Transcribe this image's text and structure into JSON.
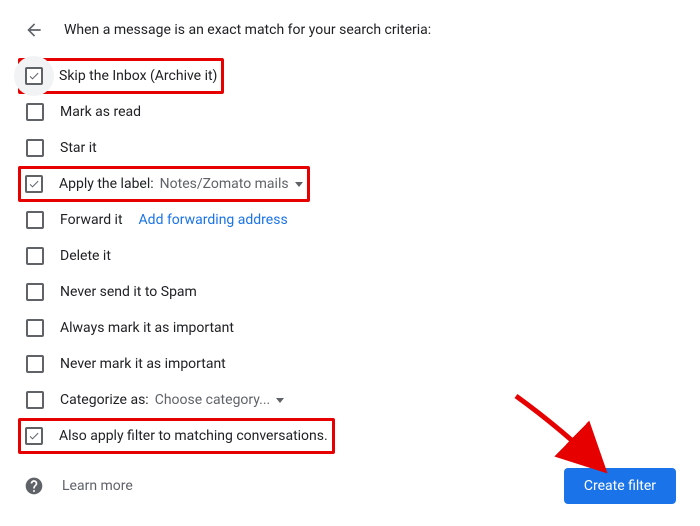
{
  "header": {
    "title": "When a message is an exact match for your search criteria:"
  },
  "options": {
    "skip_inbox": "Skip the Inbox (Archive it)",
    "mark_read": "Mark as read",
    "star": "Star it",
    "apply_label_prefix": "Apply the label:",
    "apply_label_value": "Notes/Zomato mails",
    "forward": "Forward it",
    "add_forwarding": "Add forwarding address",
    "delete": "Delete it",
    "never_spam": "Never send it to Spam",
    "always_important": "Always mark it as important",
    "never_important": "Never mark it as important",
    "categorize_prefix": "Categorize as:",
    "categorize_value": "Choose category...",
    "also_apply": "Also apply filter to matching conversations."
  },
  "footer": {
    "learn_more": "Learn more",
    "create": "Create filter"
  },
  "colors": {
    "primary": "#1a73e8",
    "highlight": "#e60000"
  }
}
